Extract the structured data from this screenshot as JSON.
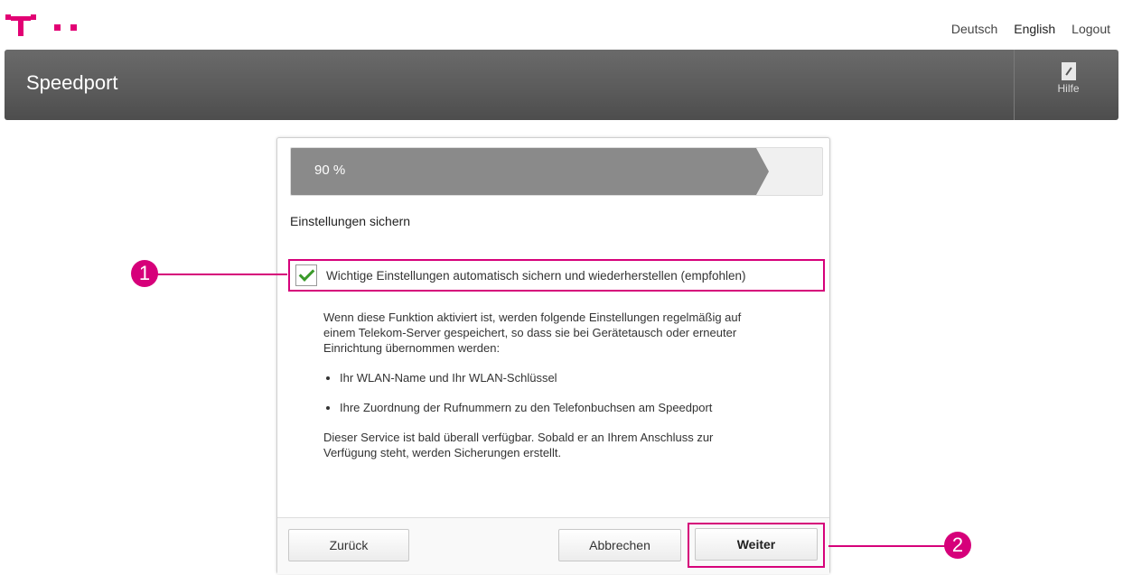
{
  "brand": {
    "logo_icon": "telekom-t-logo",
    "accent": "#d6007a"
  },
  "top_links": {
    "deutsch": "Deutsch",
    "english": "English",
    "logout": "Logout"
  },
  "header": {
    "title": "Speedport",
    "help_label": "Hilfe",
    "help_icon": "help-book-icon"
  },
  "progress": {
    "label": "90 %",
    "value": 0.9
  },
  "section": {
    "title": "Einstellungen sichern"
  },
  "checkbox": {
    "checked": true,
    "label": "Wichtige Einstellungen automatisch sichern und wiederherstellen (empfohlen)"
  },
  "description": {
    "intro": "Wenn diese Funktion aktiviert ist, werden folgende Einstellungen regelmäßig auf einem Telekom-Server gespeichert, so dass sie bei Gerätetausch oder erneuter Einrichtung übernommen werden:",
    "bullets": [
      "Ihr WLAN-Name und Ihr WLAN-Schlüssel",
      "Ihre Zuordnung der Rufnummern zu den Telefonbuchsen am Speedport"
    ],
    "outro": "Dieser Service ist bald überall verfügbar. Sobald er an Ihrem Anschluss zur Verfügung steht, werden Sicherungen erstellt."
  },
  "buttons": {
    "back": "Zurück",
    "cancel": "Abbrechen",
    "next": "Weiter"
  },
  "callouts": {
    "one": "1",
    "two": "2"
  }
}
